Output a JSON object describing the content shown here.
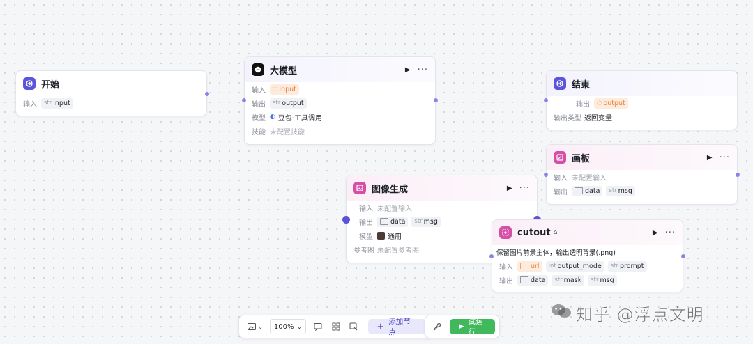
{
  "nodes": {
    "start": {
      "title": "开始",
      "inputs_label": "输入",
      "inputs": [
        {
          "type": "str",
          "name": "input"
        }
      ]
    },
    "llm": {
      "title": "大模型",
      "inputs_label": "输入",
      "input_ref": "input",
      "outputs_label": "输出",
      "output": {
        "type": "str",
        "name": "output"
      },
      "model_label": "模型",
      "model_value": "豆包·工具调用",
      "skills_label": "技能",
      "skills_value": "未配置技能"
    },
    "end": {
      "title": "结束",
      "outputs_label": "输出",
      "output_ref": "output",
      "output_type_label": "输出类型",
      "output_type_value": "返回变量"
    },
    "canvas": {
      "title": "画板",
      "inputs_label": "输入",
      "inputs_value": "未配置输入",
      "outputs_label": "输出",
      "outputs": [
        {
          "type": "",
          "name": "data"
        },
        {
          "type": "str",
          "name": "msg"
        }
      ]
    },
    "imagegen": {
      "title": "图像生成",
      "inputs_label": "输入",
      "inputs_value": "未配置输入",
      "outputs_label": "输出",
      "outputs": [
        {
          "type": "",
          "name": "data"
        },
        {
          "type": "str",
          "name": "msg"
        }
      ],
      "model_label": "模型",
      "model_value": "通用",
      "ref_label": "参考图",
      "ref_value": "未配置参考图"
    },
    "cutout": {
      "title": "cutout",
      "description": "保留图片前景主体，输出透明背景(.png)",
      "inputs_label": "输入",
      "inputs": [
        {
          "type": "",
          "name": "url"
        },
        {
          "type": "int",
          "name": "output_mode"
        },
        {
          "type": "str",
          "name": "prompt"
        }
      ],
      "outputs_label": "输出",
      "outputs": [
        {
          "type": "",
          "name": "data"
        },
        {
          "type": "str",
          "name": "mask"
        },
        {
          "type": "str",
          "name": "msg"
        }
      ]
    }
  },
  "toolbar": {
    "zoom": "100%",
    "add_node": "添加节点",
    "run": "试运行"
  },
  "watermark": "知乎 @浮点文明",
  "colors": {
    "start_icon": "#5b55d9",
    "llm_icon": "#111111",
    "end_icon": "#5b55d9",
    "canvas_icon": "#d64fa7",
    "imagegen_icon": "#d64fa7",
    "cutout_icon": "#d64fa7",
    "run_button": "#3fb95b",
    "add_button_text": "#4d46c8"
  }
}
